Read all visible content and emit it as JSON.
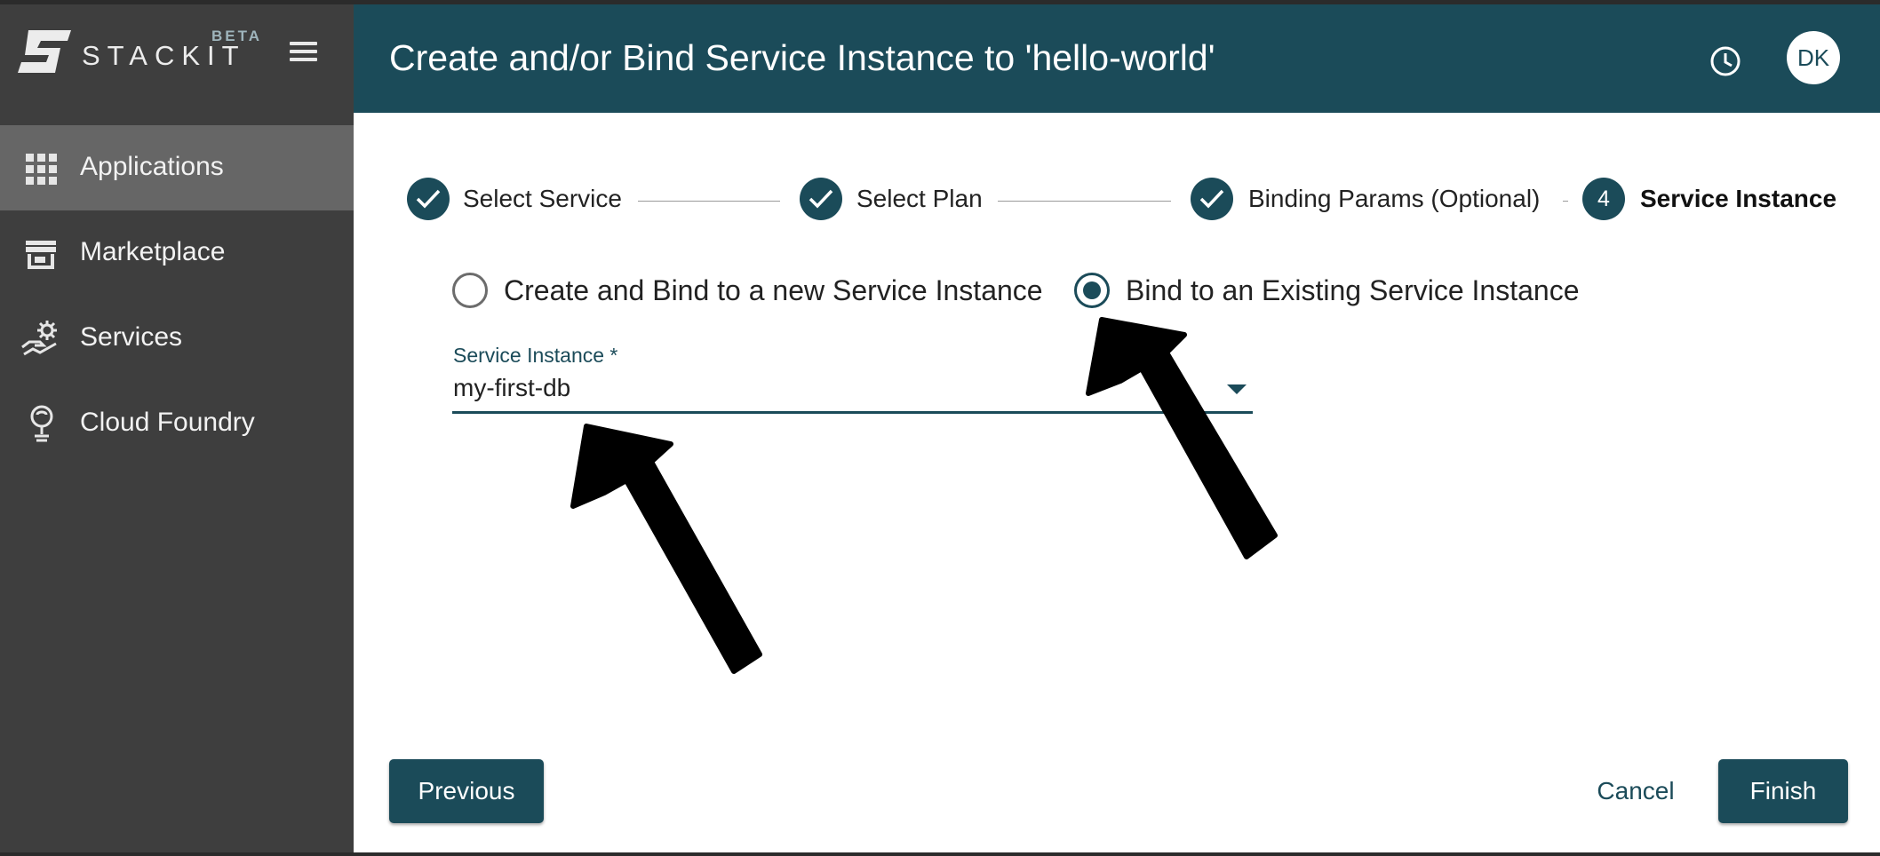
{
  "brand": {
    "name": "STACKIT",
    "badge": "BETA"
  },
  "sidebar": {
    "items": [
      {
        "label": "Applications",
        "icon": "grid-icon",
        "active": true
      },
      {
        "label": "Marketplace",
        "icon": "store-icon",
        "active": false
      },
      {
        "label": "Services",
        "icon": "service-gear-hand-icon",
        "active": false
      },
      {
        "label": "Cloud Foundry",
        "icon": "cloud-foundry-icon",
        "active": false
      }
    ]
  },
  "header": {
    "title": "Create and/or Bind Service Instance to 'hello-world'",
    "history_icon": "history-clock-icon",
    "avatar_initials": "DK"
  },
  "stepper": {
    "steps": [
      {
        "label": "Select Service",
        "state": "completed"
      },
      {
        "label": "Select Plan",
        "state": "completed"
      },
      {
        "label": "Binding Params (Optional)",
        "state": "completed"
      },
      {
        "label": "Service Instance",
        "number": "4",
        "state": "active"
      }
    ]
  },
  "options": {
    "create_new_label": "Create and Bind to a new Service Instance",
    "bind_existing_label": "Bind to an Existing Service Instance",
    "selected": "bind_existing"
  },
  "service_instance_field": {
    "label": "Service Instance *",
    "value": "my-first-db"
  },
  "actions": {
    "previous_label": "Previous",
    "cancel_label": "Cancel",
    "finish_label": "Finish"
  },
  "colors": {
    "primary": "#1b4b59",
    "sidebar_bg": "#3e3e3e",
    "sidebar_active": "#666666"
  }
}
